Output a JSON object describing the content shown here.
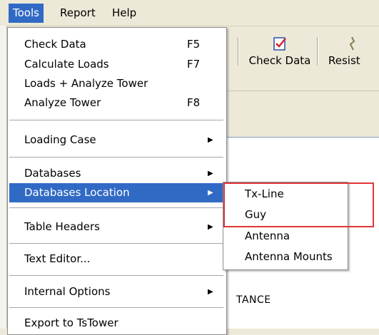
{
  "menubar": {
    "items": [
      {
        "label": "Tools"
      },
      {
        "label": "Report"
      },
      {
        "label": "Help"
      }
    ]
  },
  "toolbar": {
    "check_data_label": "Check Data",
    "resist_label": "Resist"
  },
  "content": {
    "partial_text": "TANCE"
  },
  "tools_menu": {
    "items": [
      {
        "label": "Check Data",
        "shortcut": "F5"
      },
      {
        "label": "Calculate Loads",
        "shortcut": "F7"
      },
      {
        "label": "Loads + Analyze Tower",
        "shortcut": ""
      },
      {
        "label": "Analyze Tower",
        "shortcut": "F8"
      },
      {
        "label": "Loading Case",
        "submenu": true
      },
      {
        "label": "Databases",
        "submenu": true
      },
      {
        "label": "Databases Location",
        "submenu": true,
        "highlighted": true
      },
      {
        "label": "Table Headers",
        "submenu": true
      },
      {
        "label": "Text Editor...",
        "shortcut": ""
      },
      {
        "label": "Internal Options",
        "submenu": true
      },
      {
        "label": "Export to TsTower",
        "shortcut": ""
      }
    ]
  },
  "submenu": {
    "items": [
      {
        "label": "Tx-Line"
      },
      {
        "label": "Guy"
      },
      {
        "label": "Antenna"
      },
      {
        "label": "Antenna Mounts"
      }
    ]
  },
  "colors": {
    "highlight": "#316ac5",
    "annotation_box": "#e0363a",
    "menu_background": "#ffffff",
    "chrome": "#ece9d8"
  }
}
